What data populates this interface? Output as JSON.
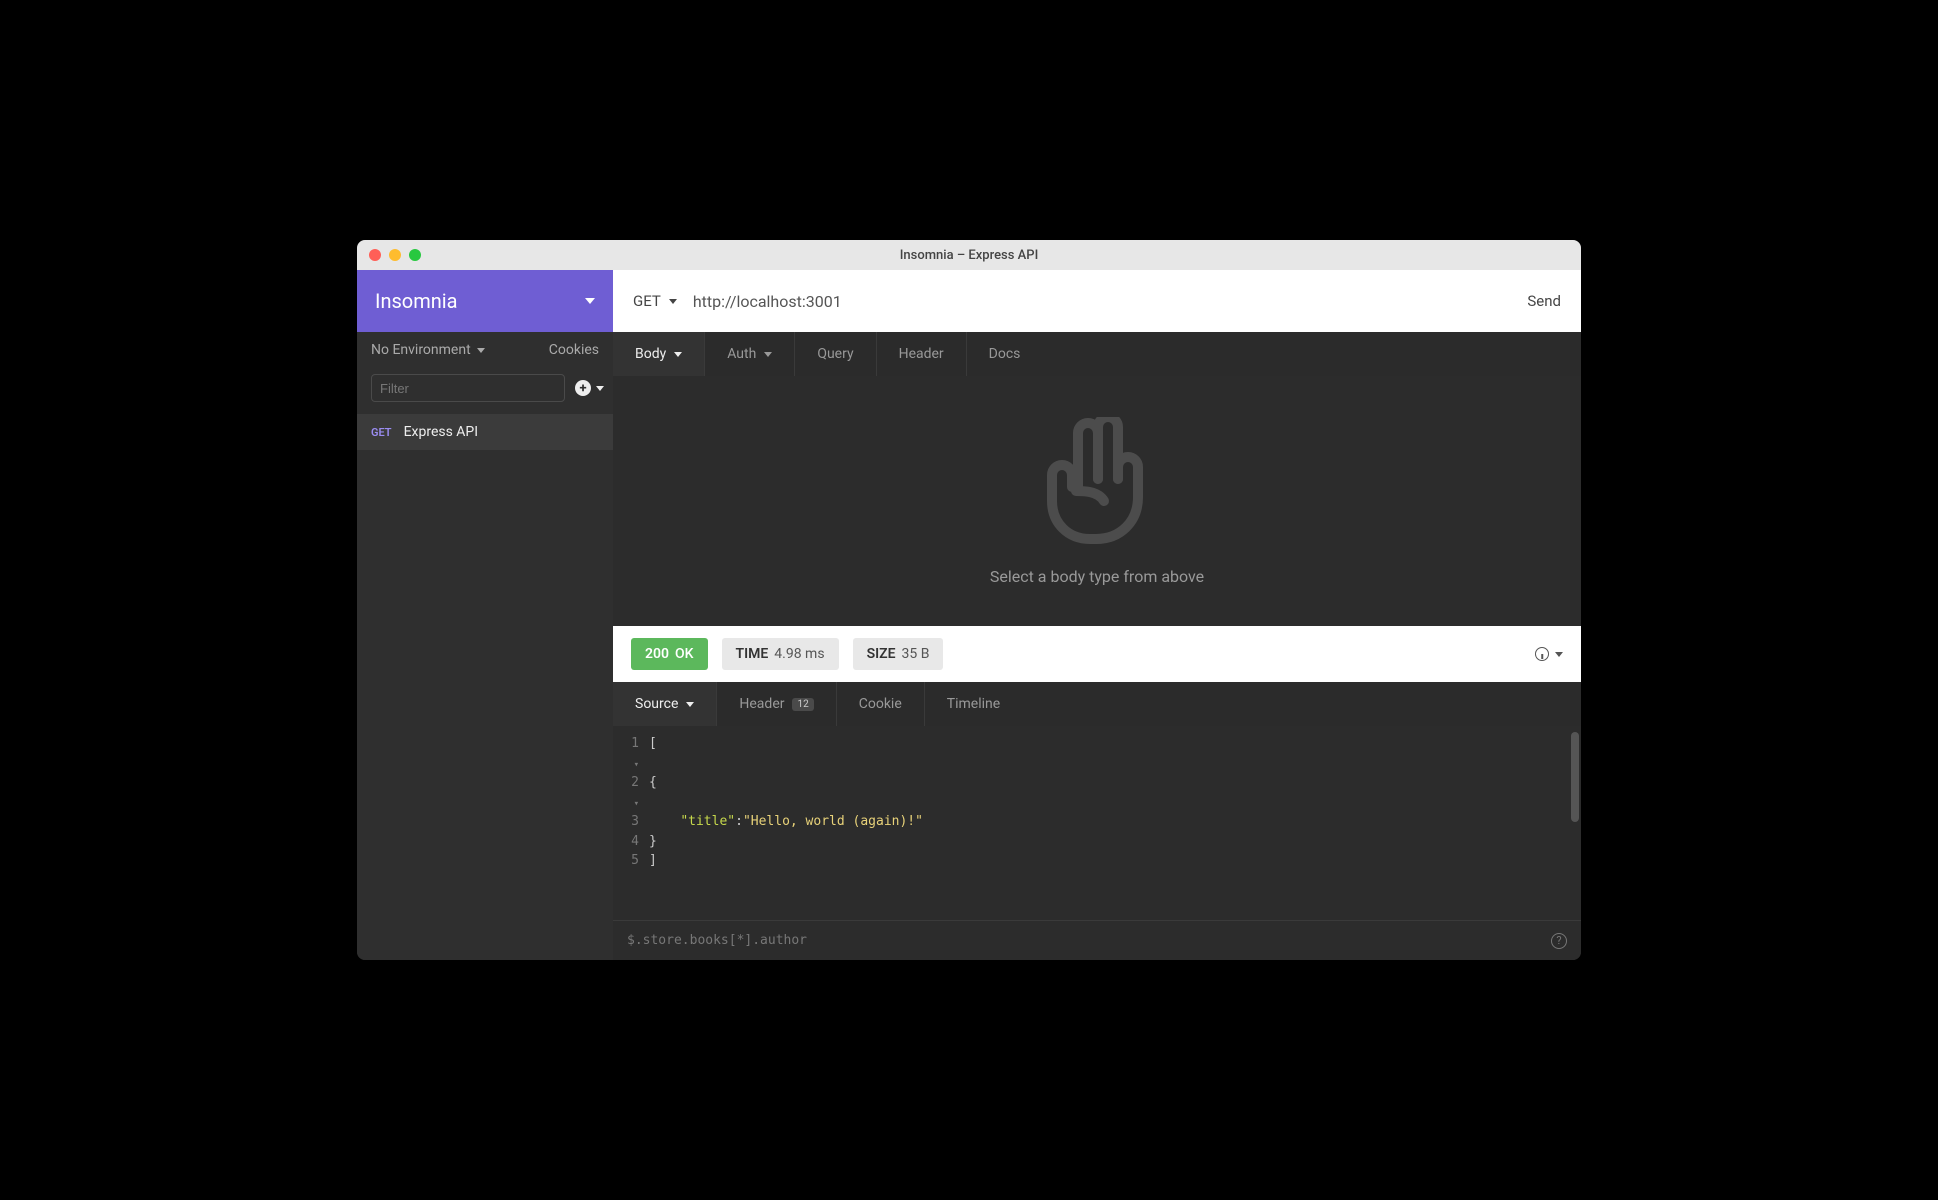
{
  "window": {
    "title": "Insomnia – Express API"
  },
  "sidebar": {
    "appName": "Insomnia",
    "environment": "No Environment",
    "cookiesLabel": "Cookies",
    "filterPlaceholder": "Filter",
    "requests": [
      {
        "method": "GET",
        "name": "Express API"
      }
    ]
  },
  "request": {
    "method": "GET",
    "url": "http://localhost:3001",
    "sendLabel": "Send",
    "tabs": {
      "body": "Body",
      "auth": "Auth",
      "query": "Query",
      "header": "Header",
      "docs": "Docs"
    },
    "bodyHint": "Select a body type from above"
  },
  "response": {
    "status": {
      "code": "200",
      "text": "OK"
    },
    "time": {
      "label": "TIME",
      "value": "4.98 ms"
    },
    "size": {
      "label": "SIZE",
      "value": "35 B"
    },
    "tabs": {
      "source": "Source",
      "header": "Header",
      "headerCount": "12",
      "cookie": "Cookie",
      "timeline": "Timeline"
    },
    "code": {
      "l1": "[",
      "l2": "  {",
      "l3_key": "\"title\"",
      "l3_colon": ": ",
      "l3_val": "\"Hello, world (again)!\"",
      "l4": "  }",
      "l5": "]"
    },
    "jsonpathPlaceholder": "$.store.books[*].author"
  }
}
